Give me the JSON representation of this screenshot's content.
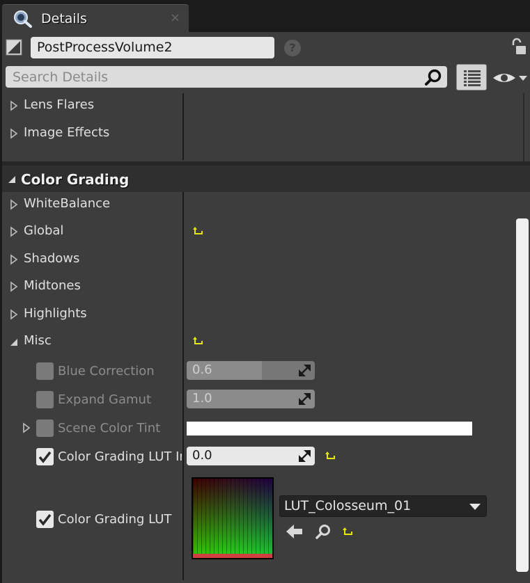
{
  "tab": {
    "title": "Details",
    "close": "×"
  },
  "object": {
    "name": "PostProcessVolume2",
    "help": "?"
  },
  "search": {
    "placeholder": "Search Details"
  },
  "lens_section": {
    "items": [
      {
        "label": "Lens Flares"
      },
      {
        "label": "Image Effects"
      }
    ]
  },
  "color_grading": {
    "title": "Color Grading",
    "groups": [
      {
        "label": "WhiteBalance"
      },
      {
        "label": "Global"
      },
      {
        "label": "Shadows"
      },
      {
        "label": "Midtones"
      },
      {
        "label": "Highlights"
      },
      {
        "label": "Misc"
      }
    ],
    "misc": {
      "blue_correction": {
        "label": "Blue Correction",
        "value": "0.6",
        "enabled": false,
        "fill": 0.6
      },
      "expand_gamut": {
        "label": "Expand Gamut",
        "value": "1.0",
        "enabled": false
      },
      "scene_color_tint": {
        "label": "Scene Color Tint",
        "enabled": false,
        "color": "#ffffff"
      },
      "lut_intensity": {
        "label": "Color Grading LUT In",
        "value": "0.0",
        "enabled": true
      },
      "lut": {
        "label": "Color Grading LUT",
        "asset": "LUT_Colosseum_01",
        "enabled": true
      }
    }
  },
  "colors": {
    "reset": "#e8e800",
    "panel": "#3d3d3d",
    "header": "#2f2f2f"
  }
}
